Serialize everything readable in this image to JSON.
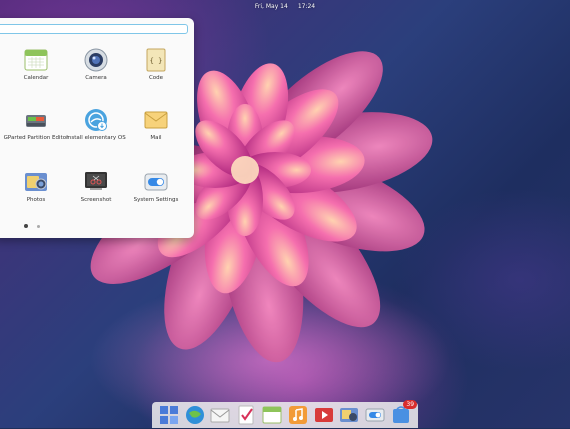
{
  "panel": {
    "date": "Fri, May 14",
    "time": "17:24"
  },
  "launcher": {
    "search_placeholder": "",
    "apps": [
      {
        "label": "Calendar",
        "icon": "calendar-icon"
      },
      {
        "label": "Camera",
        "icon": "camera-icon"
      },
      {
        "label": "Code",
        "icon": "code-icon"
      },
      {
        "label": "GParted Partition Editor",
        "icon": "gparted-icon"
      },
      {
        "label": "Install elementary OS",
        "icon": "installer-icon"
      },
      {
        "label": "Mail",
        "icon": "mail-icon"
      },
      {
        "label": "Photos",
        "icon": "photos-icon"
      },
      {
        "label": "Screenshot",
        "icon": "screenshot-icon"
      },
      {
        "label": "System Settings",
        "icon": "settings-toggle-icon"
      }
    ],
    "pages": 2,
    "current_page": 1
  },
  "dock": {
    "items": [
      "multitasking-view-icon",
      "web-browser-icon",
      "mail-icon",
      "tasks-icon",
      "calendar-icon",
      "music-icon",
      "videos-icon",
      "photos-icon",
      "settings-toggle-icon",
      "appcenter-icon"
    ],
    "appcenter_badge": "39"
  },
  "colors": {
    "accent": "#3689e6",
    "badge": "#d92d2d"
  }
}
